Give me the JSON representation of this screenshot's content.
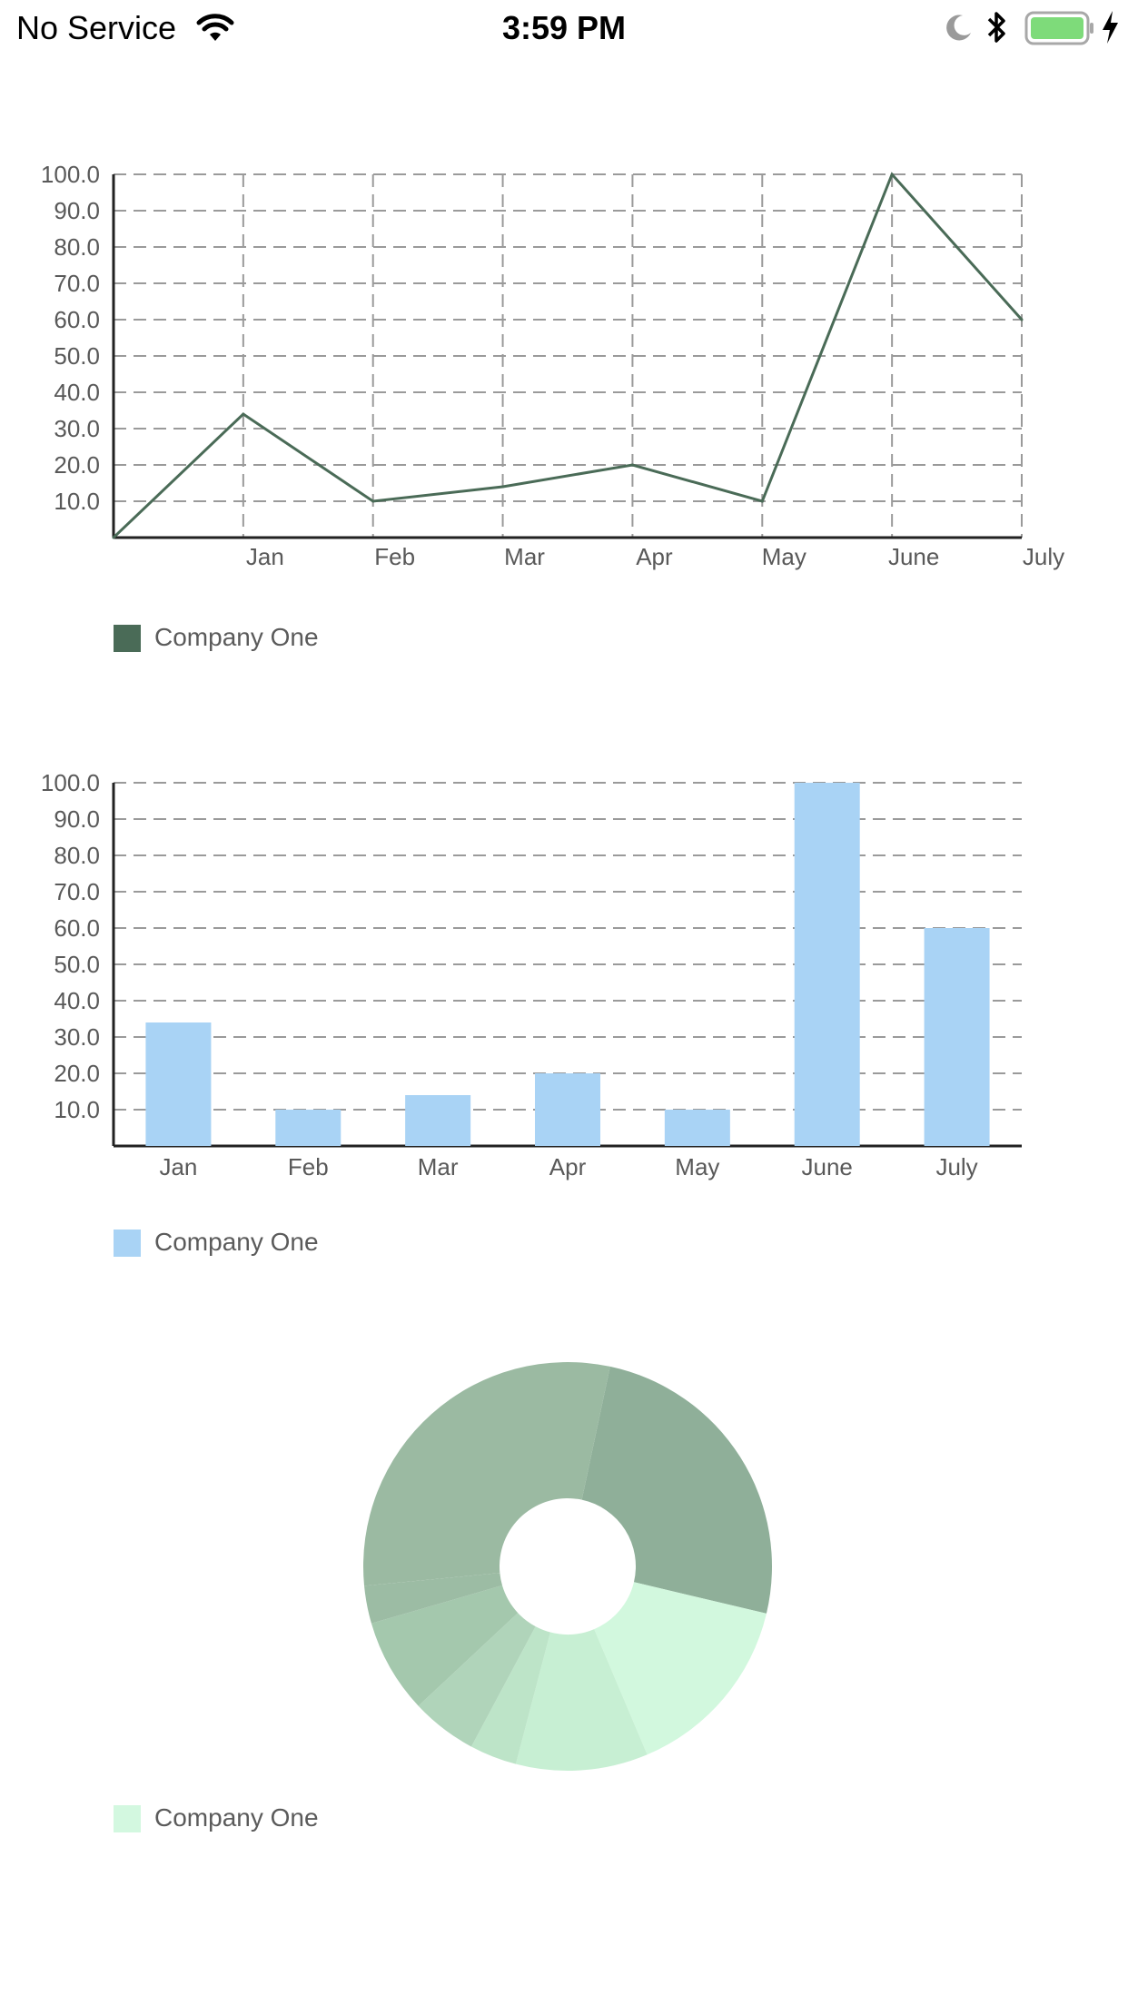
{
  "status_bar": {
    "carrier": "No Service",
    "time": "3:59 PM",
    "icons": [
      "wifi-icon",
      "moon-icon",
      "bluetooth-icon",
      "battery-icon",
      "charging-icon"
    ]
  },
  "colors": {
    "line": "#4a6b57",
    "bar": "#a9d3f5",
    "pie_legend": "#d3f8e0",
    "grid": "#9a9a9a",
    "axis_text": "#595959"
  },
  "chart_data": [
    {
      "type": "line",
      "categories": [
        "",
        "Jan",
        "Feb",
        "Mar",
        "Apr",
        "May",
        "June",
        "July"
      ],
      "y_ticks": [
        "10.0",
        "20.0",
        "30.0",
        "40.0",
        "50.0",
        "60.0",
        "70.0",
        "80.0",
        "90.0",
        "100.0"
      ],
      "series": [
        {
          "name": "Company One",
          "values": [
            0,
            34,
            10,
            14,
            20,
            10,
            100,
            60
          ]
        }
      ],
      "ylim": [
        0,
        100
      ],
      "grid": true,
      "legend": "bottom-left"
    },
    {
      "type": "bar",
      "categories": [
        "Jan",
        "Feb",
        "Mar",
        "Apr",
        "May",
        "June",
        "July"
      ],
      "y_ticks": [
        "10.0",
        "20.0",
        "30.0",
        "40.0",
        "50.0",
        "60.0",
        "70.0",
        "80.0",
        "90.0",
        "100.0"
      ],
      "series": [
        {
          "name": "Company One",
          "values": [
            34,
            10,
            14,
            20,
            10,
            100,
            60
          ]
        }
      ],
      "ylim": [
        0,
        100
      ],
      "grid": true,
      "legend": "bottom-left"
    },
    {
      "type": "pie",
      "donut": true,
      "series": [
        {
          "name": "Company One",
          "values": [
            34,
            20,
            14,
            5,
            7,
            10,
            4,
            40
          ],
          "colors": [
            "#8faf99",
            "#d2f8de",
            "#c7efd3",
            "#bde4c8",
            "#b0d4ba",
            "#a4c8ad",
            "#9cbca4",
            "#9bbaa2"
          ]
        }
      ],
      "legend": "bottom-left"
    }
  ]
}
